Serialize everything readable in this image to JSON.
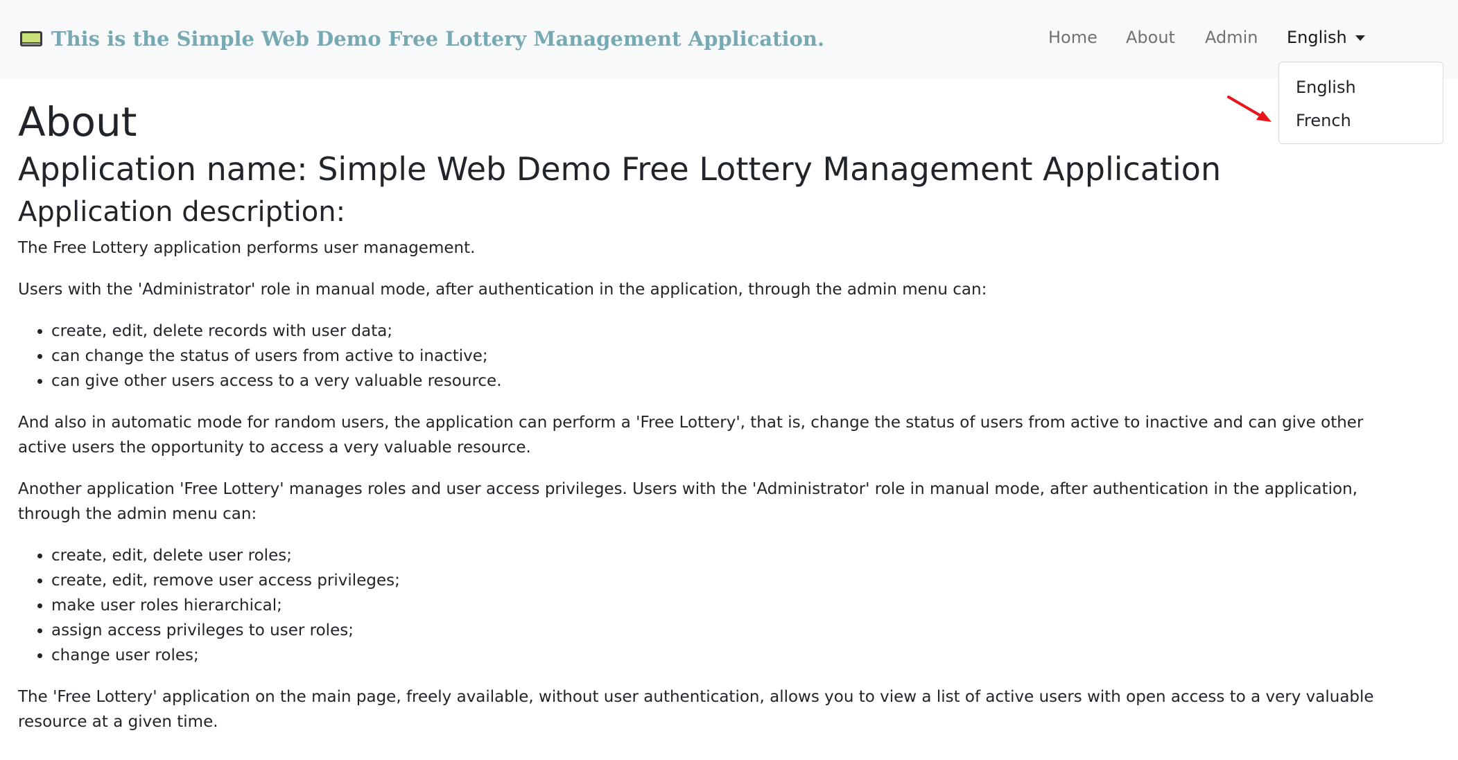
{
  "navbar": {
    "brand_text": "This is the Simple Web Demo Free Lottery Management Application.",
    "brand_icon": "monitor-icon",
    "links": {
      "home": "Home",
      "about": "About",
      "admin": "Admin"
    },
    "language_selected": "English"
  },
  "dropdown": {
    "items": [
      "English",
      "French"
    ]
  },
  "main": {
    "title": "About",
    "app_name": "Application name: Simple Web Demo Free Lottery Management Application",
    "desc_heading": "Application description:",
    "para1": "The Free Lottery application performs user management.",
    "para2": "Users with the 'Administrator' role in manual mode, after authentication in the application, through the admin menu can:",
    "list1": [
      "create, edit, delete records with user data;",
      "can change the status of users from active to inactive;",
      "can give other users access to a very valuable resource."
    ],
    "para3": "And also in automatic mode for random users, the application can perform a 'Free Lottery', that is, change the status of users from active to inactive and can give other active users the opportunity to access a very valuable resource.",
    "para4": "Another application 'Free Lottery' manages roles and user access privileges. Users with the 'Administrator' role in manual mode, after authentication in the application, through the admin menu can:",
    "list2": [
      "create, edit, delete user roles;",
      "create, edit, remove user access privileges;",
      "make user roles hierarchical;",
      "assign access privileges to user roles;",
      "change user roles;"
    ],
    "para5": "The 'Free Lottery' application on the main page, freely available, without user authentication, allows you to view a list of active users with open access to a very valuable resource at a given time."
  },
  "colors": {
    "brand": "#76a9b1",
    "navbar_bg": "#f8f9fa",
    "annotation_arrow": "#e8161b"
  }
}
